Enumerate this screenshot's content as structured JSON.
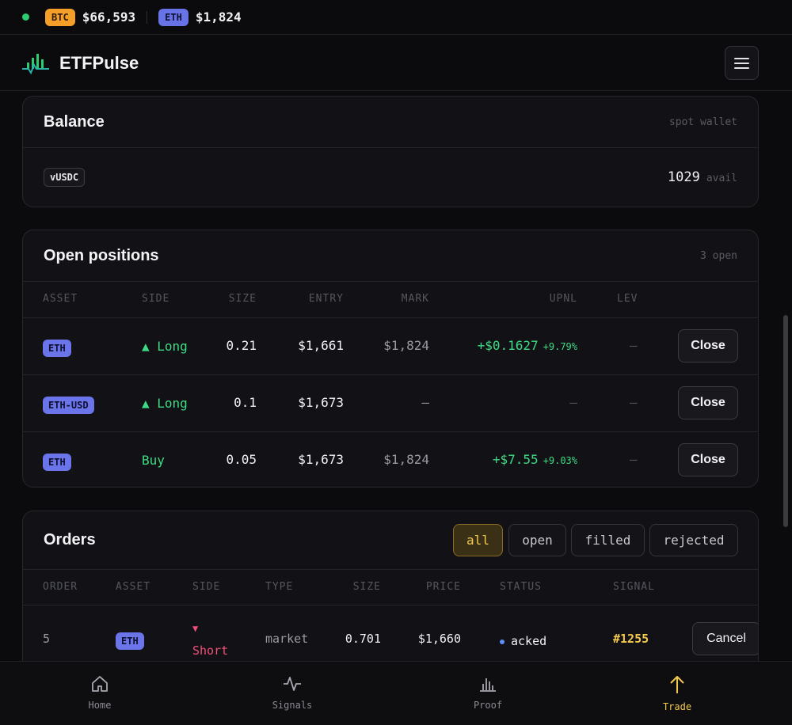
{
  "ticker": [
    {
      "symbol": "BTC",
      "price": "$66,593"
    },
    {
      "symbol": "ETH",
      "price": "$1,824"
    }
  ],
  "header": {
    "brand": "ETFPulse"
  },
  "balance": {
    "title": "Balance",
    "meta": "spot wallet",
    "token": "vUSDC",
    "amount": "1029",
    "unit": "avail"
  },
  "positions": {
    "title": "Open positions",
    "meta": "3 open",
    "columns": [
      "ASSET",
      "SIDE",
      "SIZE",
      "ENTRY",
      "MARK",
      "UPNL",
      "LEV"
    ],
    "rows": [
      {
        "asset": "ETH",
        "side": "▲ Long",
        "size": "0.21",
        "entry": "$1,661",
        "mark": "$1,824",
        "upnl": "+$0.1627",
        "upnl_pct": "+9.79%",
        "lev": "—",
        "action": "Close"
      },
      {
        "asset": "ETH-USD",
        "side": "▲ Long",
        "size": "0.1",
        "entry": "$1,673",
        "mark": "—",
        "upnl": "—",
        "upnl_pct": "",
        "lev": "—",
        "action": "Close"
      },
      {
        "asset": "ETH",
        "side": "Buy",
        "size": "0.05",
        "entry": "$1,673",
        "mark": "$1,824",
        "upnl": "+$7.55",
        "upnl_pct": "+9.03%",
        "lev": "—",
        "action": "Close"
      }
    ]
  },
  "orders": {
    "title": "Orders",
    "filters": [
      "all",
      "open",
      "filled",
      "rejected"
    ],
    "active_filter": "all",
    "columns": [
      "ORDER",
      "ASSET",
      "SIDE",
      "TYPE",
      "SIZE",
      "PRICE",
      "STATUS",
      "SIGNAL"
    ],
    "rows": [
      {
        "order": "5",
        "asset": "ETH",
        "side_arrow": "▼",
        "side": "Short",
        "type": "market",
        "size": "0.701",
        "price": "$1,660",
        "status": "acked",
        "signal": "#1255",
        "action": "Cancel"
      }
    ]
  },
  "nav": [
    {
      "label": "Home",
      "icon": "home-icon"
    },
    {
      "label": "Signals",
      "icon": "pulse-icon"
    },
    {
      "label": "Proof",
      "icon": "bar-chart-icon"
    },
    {
      "label": "Trade",
      "icon": "arrow-up-icon",
      "active": true
    }
  ],
  "colors": {
    "accent": "#f2c94c",
    "positive": "#3ddc84",
    "negative": "#f0507a",
    "asset": "#6b74e8"
  }
}
